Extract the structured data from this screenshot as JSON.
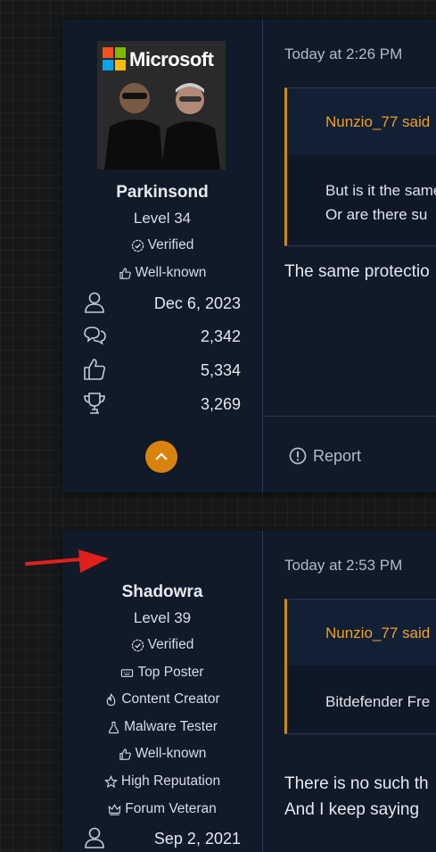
{
  "posts": [
    {
      "avatar_logo_text": "Microsoft",
      "username": "Parkinsond",
      "level": "Level 34",
      "badges": [
        {
          "icon": "verified-icon",
          "label": "Verified"
        },
        {
          "icon": "thumbs-up-icon",
          "label": "Well-known"
        }
      ],
      "stats": [
        {
          "icon": "user-icon",
          "value": "Dec 6, 2023"
        },
        {
          "icon": "comments-icon",
          "value": "2,342"
        },
        {
          "icon": "thumbs-up-icon",
          "value": "5,334"
        },
        {
          "icon": "trophy-icon",
          "value": "3,269"
        }
      ],
      "time": "Today at 2:26 PM",
      "quote_author": "Nunzio_77 said",
      "quote_lines": [
        "But is it the same",
        "Or are there su"
      ],
      "body": [
        "The same protectio"
      ],
      "report_label": "Report"
    },
    {
      "username": "Shadowra",
      "level": "Level 39",
      "badges": [
        {
          "icon": "verified-icon",
          "label": "Verified"
        },
        {
          "icon": "keyboard-icon",
          "label": "Top Poster"
        },
        {
          "icon": "flame-icon",
          "label": "Content Creator"
        },
        {
          "icon": "flask-icon",
          "label": "Malware Tester"
        },
        {
          "icon": "thumbs-up-icon",
          "label": "Well-known"
        },
        {
          "icon": "star-icon",
          "label": "High Reputation"
        },
        {
          "icon": "crown-icon",
          "label": "Forum Veteran"
        }
      ],
      "stats": [
        {
          "icon": "user-icon",
          "value": "Sep 2, 2021"
        }
      ],
      "time": "Today at 2:53 PM",
      "quote_author": "Nunzio_77 said",
      "quote_lines": [
        "Bitdefender Fre"
      ],
      "body": [
        "There is no such th",
        "And I keep saying"
      ]
    }
  ],
  "colors": {
    "accent": "#d9820c",
    "quote_author": "#f0a020",
    "panel": "#101a28",
    "border": "#2a3b55",
    "arrow": "#e0201c"
  }
}
